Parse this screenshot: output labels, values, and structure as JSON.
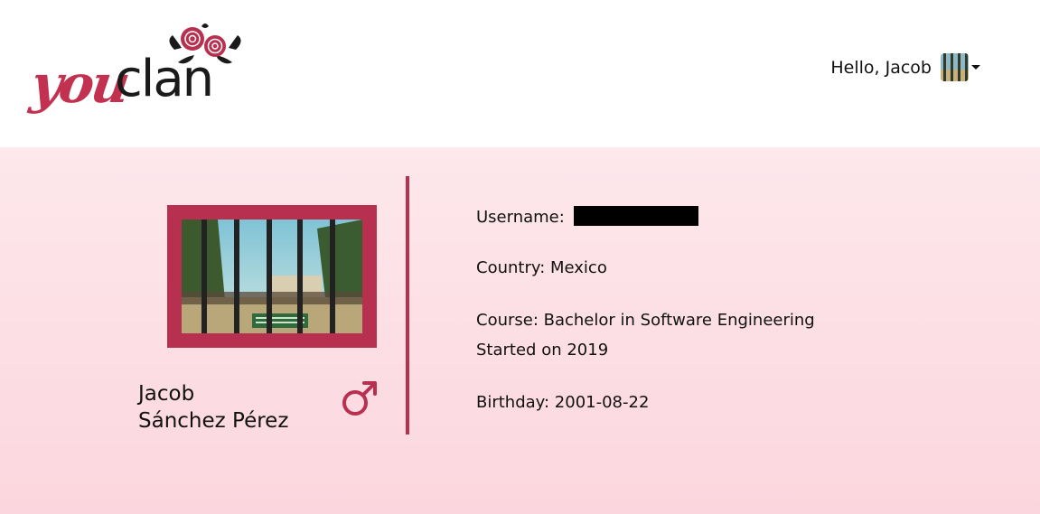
{
  "header": {
    "logo": {
      "part1": "you",
      "part2": "clan",
      "flower_color": "#b83050"
    },
    "greeting": "Hello, Jacob",
    "avatar_icon": "user-avatar-icon"
  },
  "profile": {
    "first_name": "Jacob",
    "last_name": "Sánchez Pérez",
    "gender_icon": "male-symbol-icon",
    "accent_color": "#b83050"
  },
  "details": {
    "username_label": "Username:",
    "username_value": "",
    "country": "Country: Mexico",
    "course": "Course: Bachelor in Software Engineering",
    "started": "Started on 2019",
    "birthday": "Birthday: 2001-08-22"
  }
}
